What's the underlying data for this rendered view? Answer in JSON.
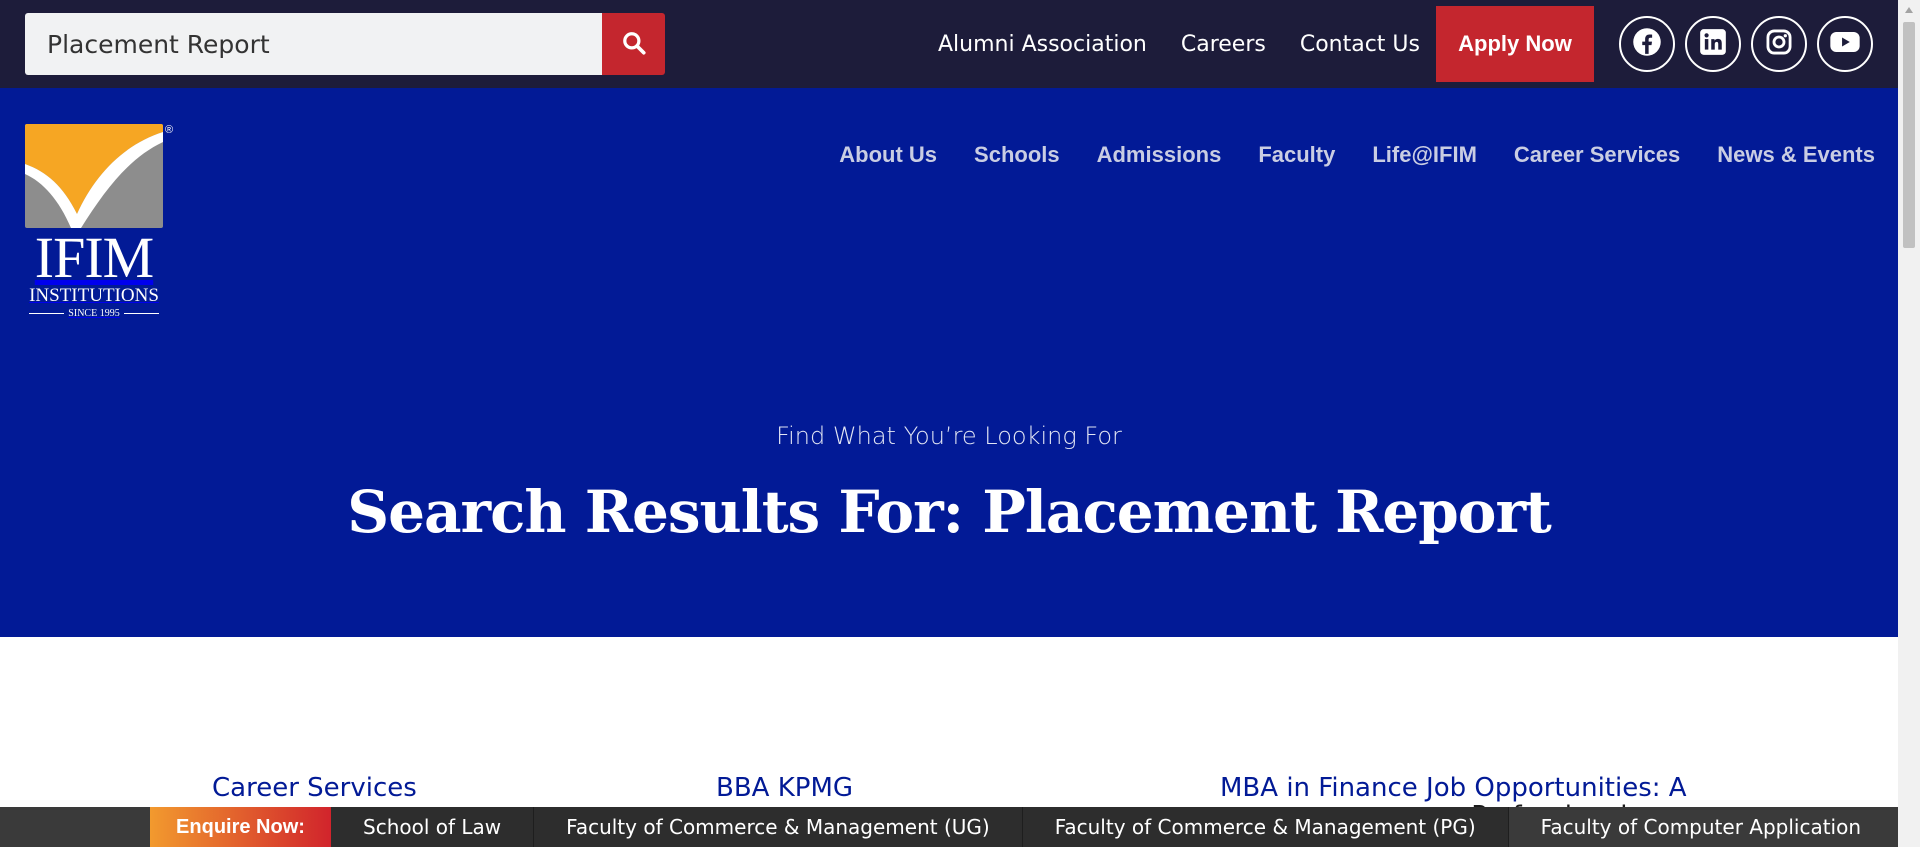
{
  "search": {
    "value": "Placement Report"
  },
  "top_links": [
    "Alumni Association",
    "Careers",
    "Contact Us"
  ],
  "apply_label": "Apply Now",
  "socials": [
    "facebook-icon",
    "linkedin-icon",
    "instagram-icon",
    "youtube-icon"
  ],
  "logo": {
    "word": "IFIM",
    "sub": "INSTITUTIONS",
    "since": "SINCE 1995",
    "reg": "®"
  },
  "nav": [
    "About Us",
    "Schools",
    "Admissions",
    "Faculty",
    "Life@IFIM",
    "Career Services",
    "News & Events"
  ],
  "hero": {
    "kicker": "Find What You’re Looking For",
    "title": "Search Results For: Placement Report"
  },
  "results": [
    "Career Services",
    "BBA KPMG",
    "MBA in Finance Job Opportunities: A"
  ],
  "results_overlap_text": "ng Professionals",
  "enquire": {
    "label": "Enquire Now:",
    "items": [
      "School of Law",
      "Faculty of Commerce & Management (UG)",
      "Faculty of Commerce & Management (PG)",
      "Faculty of Computer Application"
    ]
  },
  "colors": {
    "topbar": "#1d1c3a",
    "hero": "#021a96",
    "accent_red": "#c4262e",
    "logo_orange": "#f6a623",
    "logo_grey": "#8d8d8d"
  }
}
